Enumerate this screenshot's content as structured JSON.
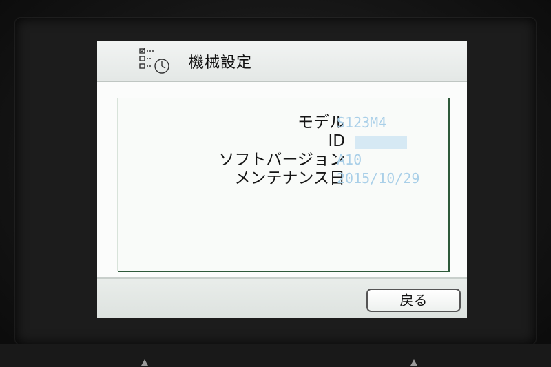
{
  "screen": {
    "title": "機械設定",
    "title_icon": "settings-checklist-clock-icon"
  },
  "info": {
    "rows": [
      {
        "label": "モデル",
        "value": "S123M4"
      },
      {
        "label": "ID",
        "value": ""
      },
      {
        "label": "ソフトバージョン",
        "value": "A10"
      },
      {
        "label": "メンテナンス日",
        "value": "2015/10/29"
      }
    ]
  },
  "footer": {
    "back_label": "戻る"
  },
  "colors": {
    "value_text": "#a9cfe8",
    "panel_border": "#2e5a3a"
  }
}
